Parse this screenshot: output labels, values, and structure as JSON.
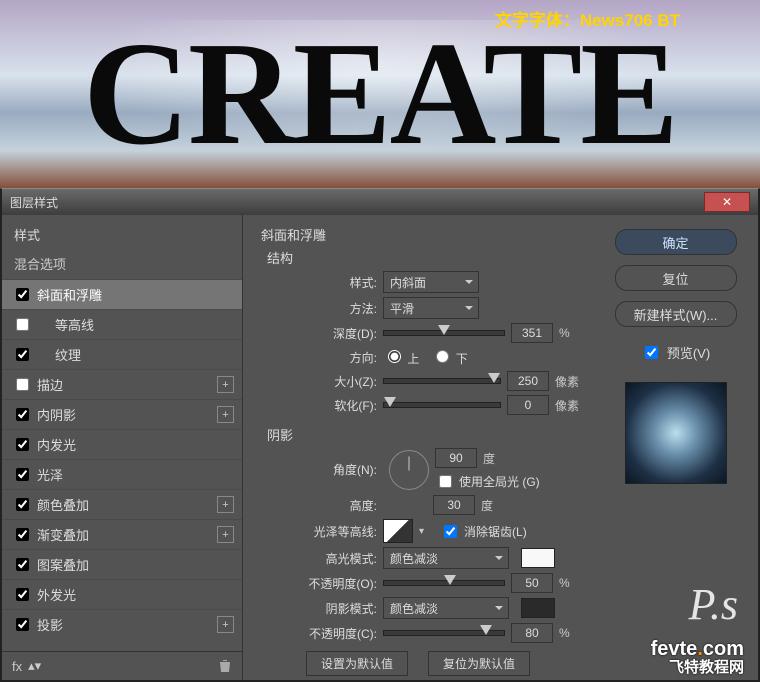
{
  "canvas": {
    "big_text": "CREATE",
    "font_label": "文字字体：News706 BT"
  },
  "dialog": {
    "title": "图层样式",
    "left": {
      "styles_header": "样式",
      "blend_options": "混合选项",
      "items": [
        {
          "label": "斜面和浮雕",
          "checked": true,
          "selected": true
        },
        {
          "label": "等高线",
          "checked": false,
          "indent": true
        },
        {
          "label": "纹理",
          "checked": true,
          "indent": true
        },
        {
          "label": "描边",
          "checked": false,
          "plus": true
        },
        {
          "label": "内阴影",
          "checked": true,
          "plus": true
        },
        {
          "label": "内发光",
          "checked": true
        },
        {
          "label": "光泽",
          "checked": true
        },
        {
          "label": "颜色叠加",
          "checked": true,
          "plus": true
        },
        {
          "label": "渐变叠加",
          "checked": true,
          "plus": true
        },
        {
          "label": "图案叠加",
          "checked": true
        },
        {
          "label": "外发光",
          "checked": true
        },
        {
          "label": "投影",
          "checked": true,
          "plus": true
        }
      ],
      "footer_fx": "fx"
    },
    "center": {
      "section_bevel": "斜面和浮雕",
      "section_structure": "结构",
      "style_label": "样式:",
      "style_value": "内斜面",
      "method_label": "方法:",
      "method_value": "平滑",
      "depth_label": "深度(D):",
      "depth_value": "351",
      "depth_unit": "%",
      "direction_label": "方向:",
      "direction_up": "上",
      "direction_down": "下",
      "size_label": "大小(Z):",
      "size_value": "250",
      "size_unit": "像素",
      "soften_label": "软化(F):",
      "soften_value": "0",
      "soften_unit": "像素",
      "section_shading": "阴影",
      "angle_label": "角度(N):",
      "angle_value": "90",
      "angle_unit": "度",
      "global_light_label": "使用全局光 (G)",
      "altitude_label": "高度:",
      "altitude_value": "30",
      "altitude_unit": "度",
      "gloss_contour_label": "光泽等高线:",
      "anti_alias_label": "消除锯齿(L)",
      "highlight_mode_label": "高光模式:",
      "highlight_mode_value": "颜色减淡",
      "highlight_opacity_label": "不透明度(O):",
      "highlight_opacity_value": "50",
      "percent": "%",
      "shadow_mode_label": "阴影模式:",
      "shadow_mode_value": "颜色减淡",
      "shadow_opacity_label": "不透明度(C):",
      "shadow_opacity_value": "80",
      "make_default": "设置为默认值",
      "reset_default": "复位为默认值"
    },
    "right": {
      "ok": "确定",
      "reset": "复位",
      "new_style": "新建样式(W)...",
      "preview": "预览(V)"
    }
  },
  "sig": "P.s",
  "watermark": {
    "url": "fevte.com",
    "text": "飞特教程网"
  }
}
